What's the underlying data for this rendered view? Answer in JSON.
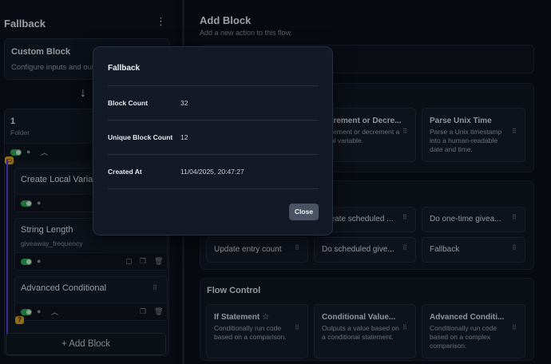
{
  "left": {
    "title": "Fallback",
    "custom_block": {
      "title": "Custom Block",
      "desc": "Configure inputs and outputs"
    },
    "folder": {
      "name": "1",
      "subtitle": "Folder"
    },
    "blocks": [
      {
        "title": "Create Local Variable",
        "value": ""
      },
      {
        "title": "String Length",
        "value": "giveaway_frequency"
      },
      {
        "title": "Advanced Conditional",
        "value": ""
      }
    ],
    "add_block_label": "+ Add Block"
  },
  "right": {
    "title": "Add Block",
    "subtitle": "Add a new action to this flow.",
    "row1_tiles": [
      {
        "title": "Increment or Decre...",
        "desc": "Increment or decrement a local variable."
      },
      {
        "title": "Parse Unix Time",
        "desc": "Parse a Unix timestamp into a human-readable date and time."
      }
    ],
    "row2_tiles": [
      {
        "title": "Create scheduled ..."
      },
      {
        "title": "Do one-time givea..."
      },
      {
        "title": "Update entry count"
      },
      {
        "title": "Do scheduled give..."
      },
      {
        "title": "Fallback"
      }
    ],
    "flow_control": {
      "title": "Flow Control",
      "tiles": [
        {
          "title": "If Statement",
          "desc": "Conditionally run code based on a comparison."
        },
        {
          "title": "Conditional Value...",
          "desc": "Outputs a value based on a conditional statement."
        },
        {
          "title": "Advanced Conditi...",
          "desc": "Conditionally run code based on a complex comparison."
        }
      ]
    }
  },
  "modal": {
    "title": "Fallback",
    "rows": [
      {
        "label": "Block Count",
        "value": "32"
      },
      {
        "label": "Unique Block Count",
        "value": "12"
      },
      {
        "label": "Created At",
        "value": "11/04/2025, 20:47:27"
      }
    ],
    "close_label": "Close"
  },
  "colors": {
    "toggle_on": "#2fae5b",
    "accent_line": "#5b3df0",
    "badge": "#e3a822"
  }
}
